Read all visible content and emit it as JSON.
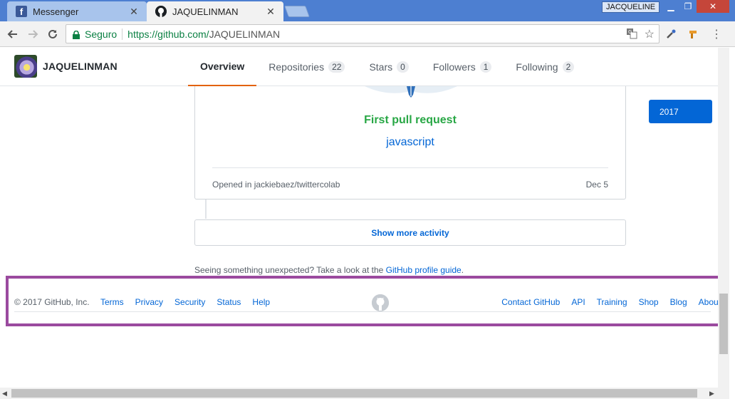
{
  "browser": {
    "tabs": [
      {
        "title": "Messenger",
        "favicon": "facebook-icon",
        "active": false
      },
      {
        "title": "JAQUELINMAN",
        "favicon": "github-icon",
        "active": true
      }
    ],
    "profile_name": "JACQUELINE",
    "secure_label": "Seguro",
    "url_host": "https://github.com/",
    "url_path": "JAQUELINMAN"
  },
  "profile": {
    "username": "JAQUELINMAN",
    "tabs": [
      {
        "label": "Overview",
        "count": null
      },
      {
        "label": "Repositories",
        "count": "22"
      },
      {
        "label": "Stars",
        "count": "0"
      },
      {
        "label": "Followers",
        "count": "1"
      },
      {
        "label": "Following",
        "count": "2"
      }
    ],
    "year_button": "2017"
  },
  "activity": {
    "card_title": "First pull request",
    "language": "javascript",
    "opened_in": "Opened in jackiebaez/twittercolab",
    "date": "Dec 5",
    "show_more": "Show more activity",
    "guide_prefix": "Seeing something unexpected? Take a look at the ",
    "guide_link": "GitHub profile guide",
    "guide_suffix": "."
  },
  "footer": {
    "copyright": "© 2017 GitHub, Inc.",
    "left_links": [
      "Terms",
      "Privacy",
      "Security",
      "Status",
      "Help"
    ],
    "right_links": [
      "Contact GitHub",
      "API",
      "Training",
      "Shop",
      "Blog",
      "About"
    ],
    "highlight_color": "#9b4a9f"
  },
  "colors": {
    "accent": "#0366d6",
    "success": "#28a745",
    "tab_underline": "#e36209"
  }
}
